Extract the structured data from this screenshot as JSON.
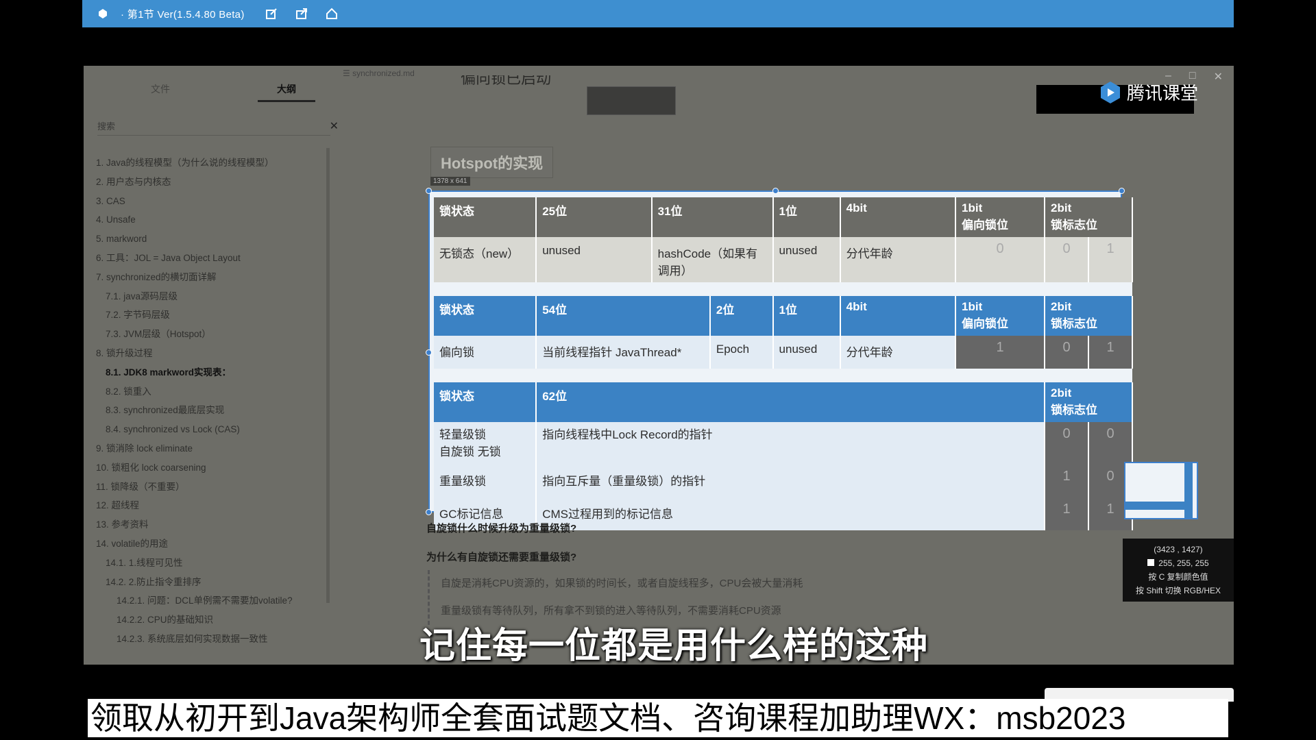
{
  "titlebar": {
    "title": "· 第1节 Ver(1.5.4.80 Beta)"
  },
  "sidebar": {
    "tabs": [
      "文件",
      "大纲"
    ],
    "search_placeholder": "搜索",
    "toc": [
      {
        "label": "1. Java的线程模型（为什么说的线程模型）",
        "level": 1
      },
      {
        "label": "2. 用户态与内核态",
        "level": 1
      },
      {
        "label": "3. CAS",
        "level": 1
      },
      {
        "label": "4. Unsafe",
        "level": 1
      },
      {
        "label": "5. markword",
        "level": 1
      },
      {
        "label": "6. 工具：JOL = Java Object Layout",
        "level": 1
      },
      {
        "label": "7. synchronized的横切面详解",
        "level": 1
      },
      {
        "label": "7.1. java源码层级",
        "level": 2
      },
      {
        "label": "7.2. 字节码层级",
        "level": 2
      },
      {
        "label": "7.3. JVM层级（Hotspot）",
        "level": 2
      },
      {
        "label": "8. 锁升级过程",
        "level": 1
      },
      {
        "label": "8.1. JDK8 markword实现表：",
        "level": 2,
        "active": true
      },
      {
        "label": "8.2. 锁重入",
        "level": 2
      },
      {
        "label": "8.3. synchronized最底层实现",
        "level": 2
      },
      {
        "label": "8.4. synchronized vs Lock (CAS)",
        "level": 2
      },
      {
        "label": "9. 锁消除 lock eliminate",
        "level": 1
      },
      {
        "label": "10. 锁粗化 lock coarsening",
        "level": 1
      },
      {
        "label": "11. 锁降级（不重要）",
        "level": 1
      },
      {
        "label": "12. 超线程",
        "level": 1
      },
      {
        "label": "13. 参考资料",
        "level": 1
      },
      {
        "label": "14. volatile的用途",
        "level": 1
      },
      {
        "label": "14.1. 1.线程可见性",
        "level": 2
      },
      {
        "label": "14.2. 2.防止指令重排序",
        "level": 2
      },
      {
        "label": "14.2.1. 问题：DCL单例需不需要加volatile?",
        "level": 3
      },
      {
        "label": "14.2.2. CPU的基础知识",
        "level": 3
      },
      {
        "label": "14.2.3. 系统底层如何实现数据一致性",
        "level": 3
      }
    ]
  },
  "doc": {
    "tab_name": "synchronized.md",
    "partial_heading": "偏向锁已启动",
    "logo_text": "腾讯课堂",
    "section_title": "Hotspot的实现",
    "image_size": "1378 x 641"
  },
  "markword": {
    "block1": {
      "header": [
        "锁状态",
        "25位",
        "31位",
        "1位",
        "4bit",
        "1bit\n偏向锁位",
        "2bit\n锁标志位"
      ],
      "row": {
        "state": "无锁态（new）",
        "c25": "unused",
        "c31": "hashCode（如果有调用）",
        "c1": "unused",
        "age": "分代年龄",
        "biased": "0",
        "flag1": "0",
        "flag2": "1"
      }
    },
    "block2": {
      "header": [
        "锁状态",
        "54位",
        "2位",
        "1位",
        "4bit",
        "1bit\n偏向锁位",
        "2bit\n锁标志位"
      ],
      "row": {
        "state": "偏向锁",
        "c54": "当前线程指针 JavaThread*",
        "c2": "Epoch",
        "c1": "unused",
        "age": "分代年龄",
        "biased": "1",
        "flag1": "0",
        "flag2": "1"
      }
    },
    "block3": {
      "header": [
        "锁状态",
        "62位",
        "2bit\n锁标志位"
      ],
      "rows": [
        {
          "state": "轻量级锁\n自旋锁 无锁",
          "value": "指向线程栈中Lock Record的指针",
          "flag1": "0",
          "flag2": "0"
        },
        {
          "state": "重量级锁",
          "value": "指向互斥量（重量级锁）的指针",
          "flag1": "1",
          "flag2": "0"
        },
        {
          "state": "GC标记信息",
          "value": "CMS过程用到的标记信息",
          "flag1": "1",
          "flag2": "1"
        }
      ]
    }
  },
  "questions": {
    "q1": "自旋锁什么时候升级为重量级锁?",
    "q2": "为什么有自旋锁还需要重量级锁?",
    "quote1": "自旋是消耗CPU资源的，如果锁的时间长，或者自旋线程多，CPU会被大量消耗",
    "quote2": "重量级锁有等待队列，所有拿不到锁的进入等待队列，不需要消耗CPU资源"
  },
  "picker": {
    "coords": "(3423 , 1427)",
    "rgb": "255, 255, 255",
    "hint1": "按 C 复制颜色值",
    "hint2": "按 Shift 切换 RGB/HEX"
  },
  "subtitles": {
    "center": "记住每一位都是用什么样的这种",
    "banner": "领取从初开到Java架构师全套面试题文档、咨询课程加助理WX：msb2023"
  },
  "colors": {
    "accent": "#3b82c4",
    "titlebar": "#3e8fd0"
  }
}
